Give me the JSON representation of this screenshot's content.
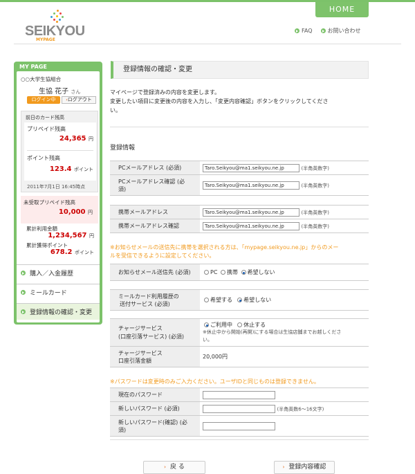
{
  "header": {
    "home": "HOME",
    "logo_name": "SEIKYOU",
    "logo_sub": "MYPAGE",
    "faq": "FAQ",
    "contact": "お問い合わせ"
  },
  "sidebar": {
    "title": "MY PAGE",
    "org": "○○大学生協組合",
    "user_name": "生協 花子",
    "user_suffix": "さん",
    "login_label": "ログイン中",
    "logout_label": "ログアウト",
    "card_title": "前日のカード残高",
    "prepaid_label": "プリペイド残高",
    "prepaid_value": "24,365",
    "yen": "円",
    "point_label": "ポイント残高",
    "point_value": "123.4",
    "point_unit": "ポイント",
    "timestamp": "2011年7月1日 16:45時点",
    "unreceived_label": "未受取プリペイド残高",
    "unreceived_value": "10,000",
    "total_use_label": "累計利用金額",
    "total_use_value": "1,234,567",
    "total_point_label": "累計獲得ポイント",
    "total_point_value": "678.2",
    "menu": [
      "購入／入金履歴",
      "ミールカード",
      "登録情報の確認・変更"
    ]
  },
  "main": {
    "title": "登録情報の確認・変更",
    "intro1": "マイページで登録済みの内容を変更します。",
    "intro2": "変更したい項目に変更後の内容を入力し、「変更内容確認」ボタンをクリックしてくださ",
    "intro3": "い。",
    "section": "登録情報",
    "email_value": "Taro.Seikyou@ma1.seikyou.ne.jp",
    "hankaku": "(半角英数字)",
    "pc_mail": "PCメールアドレス (必須)",
    "pc_mail_confirm_1": "PCメールアドレス確認 (必",
    "pc_mail_confirm_2": "須)",
    "mobile_mail": "携帯メールアドレス",
    "mobile_mail_confirm": "携帯メールアドレス確認",
    "note_mobile_1": "※お知らせメールの送信先に携帯を選択される方は、「mypage.seikyou.ne.jp」からのメー",
    "note_mobile_2": "ルを受信できるように設定してください。",
    "notify_label": "お知らせメール送信先 (必須)",
    "notify_opts": [
      "PC",
      "携帯",
      "希望しない"
    ],
    "meal_label_1": "ミールカード利用履歴の",
    "meal_label_2": "送付サービス (必須)",
    "meal_opts": [
      "希望する",
      "希望しない"
    ],
    "charge_label_1": "チャージサービス",
    "charge_label_2": "(口座引落サービス) (必須)",
    "charge_opts": [
      "ご利用中",
      "休止する"
    ],
    "charge_note_1": "※休止中から開始(再開)にする場合は生協店舗までお越しくださ",
    "charge_note_2": "い。",
    "charge_amt_label_1": "チャージサービス",
    "charge_amt_label_2": "口座引落金額",
    "charge_amt_value": "20,000円",
    "note_pw": "※パスワードは変更時のみご入力ください。ユーザIDと同じものは登録できません。",
    "pw_current": "現在のパスワード",
    "pw_new": "新しいパスワード (必須)",
    "pw_new_hint": "(半角英数6〜16文字)",
    "pw_confirm_1": "新しいパスワード(確認) (必",
    "pw_confirm_2": "須)",
    "back_button": "戻 る",
    "confirm_button": "登録内容確認"
  }
}
